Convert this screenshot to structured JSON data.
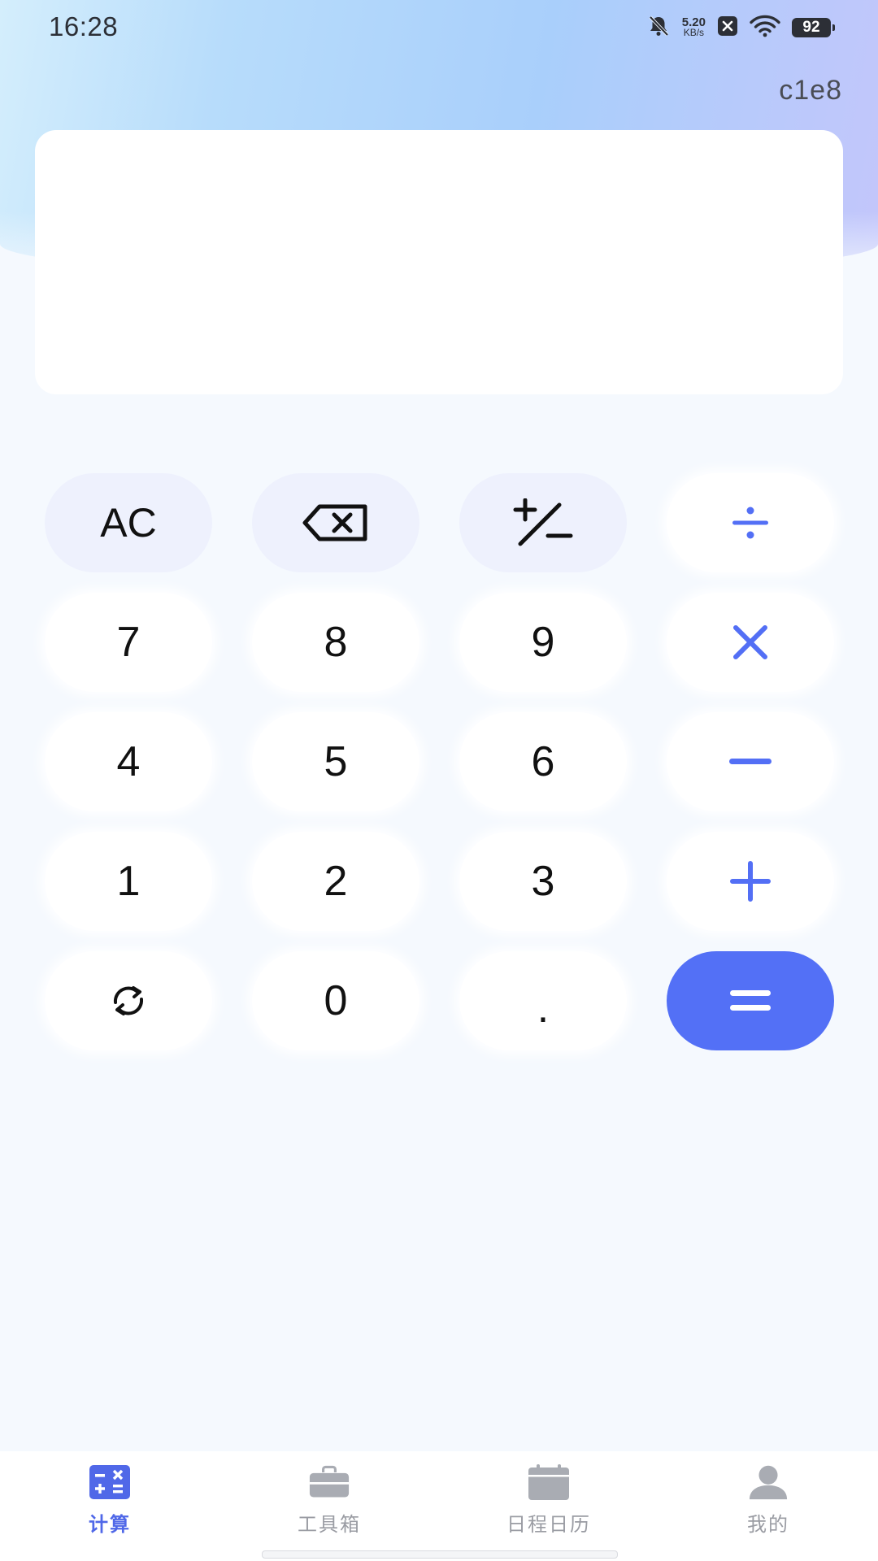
{
  "status_bar": {
    "time": "16:28",
    "net_speed_value": "5.20",
    "net_speed_unit": "KB/s",
    "battery": "92"
  },
  "mode_label": "c1e8",
  "display": {
    "value": ""
  },
  "keypad": {
    "ac": "AC",
    "backspace_icon": "backspace-icon",
    "sign_icon": "plus-minus-icon",
    "divide": "÷",
    "seven": "7",
    "eight": "8",
    "nine": "9",
    "multiply": "×",
    "four": "4",
    "five": "5",
    "six": "6",
    "minus": "−",
    "one": "1",
    "two": "2",
    "three": "3",
    "plus": "+",
    "refresh_icon": "refresh-icon",
    "zero": "0",
    "dot": ".",
    "equals": "="
  },
  "nav": {
    "items": [
      {
        "label": "计算",
        "icon": "calculator-icon",
        "active": true
      },
      {
        "label": "工具箱",
        "icon": "toolbox-icon",
        "active": false
      },
      {
        "label": "日程日历",
        "icon": "calendar-icon",
        "active": false
      },
      {
        "label": "我的",
        "icon": "user-icon",
        "active": false
      }
    ]
  },
  "colors": {
    "accent": "#536ff5",
    "nav_active": "#5068e8",
    "nav_inactive": "#9a9ca3",
    "func_key_bg": "#eef1fd"
  }
}
